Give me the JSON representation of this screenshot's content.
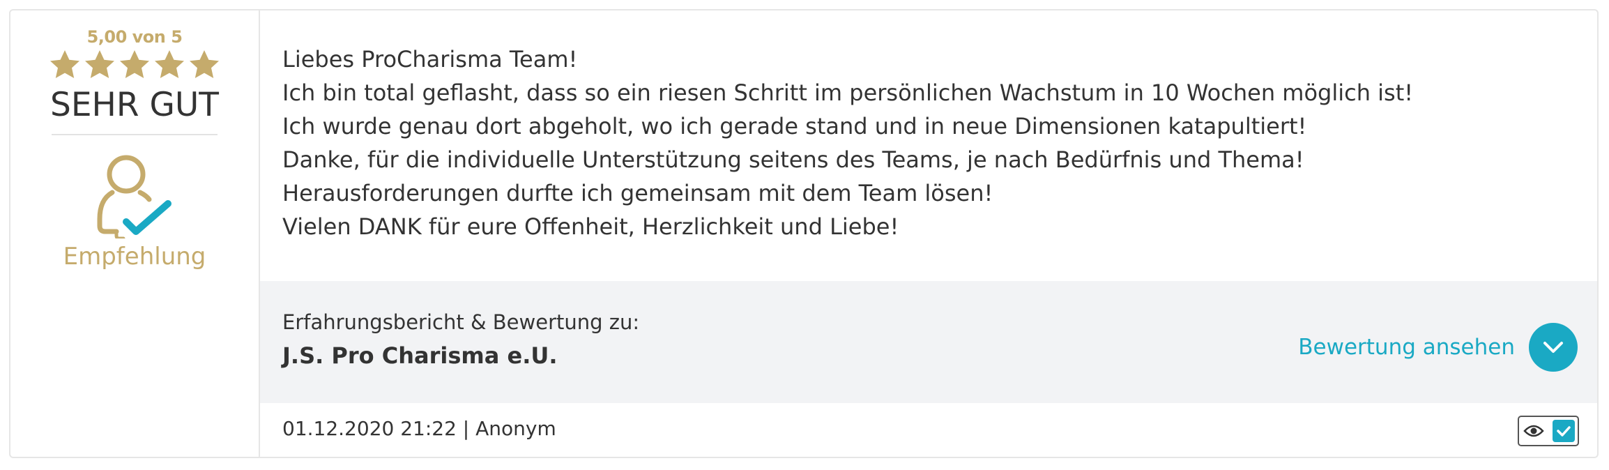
{
  "rating": {
    "score_text": "5,00 von 5",
    "stars": 5,
    "word": "SEHR GUT",
    "recommendation_label": "Empfehlung",
    "star_color": "#c5ab6c"
  },
  "review": {
    "lines": [
      "Liebes ProCharisma Team!",
      "Ich bin total geflasht, dass so ein riesen Schritt im persönlichen Wachstum in 10 Wochen möglich ist!",
      "Ich wurde genau dort abgeholt, wo ich gerade stand und in neue Dimensionen katapultiert!",
      "Danke, für die individuelle Unterstützung seitens des Teams, je nach Bedürfnis und Thema!",
      "Herausforderungen durfte ich gemeinsam mit dem Team lösen!",
      "Vielen DANK für eure Offenheit, Herzlichkeit und Liebe!"
    ]
  },
  "company": {
    "caption": "Erfahrungsbericht & Bewertung zu:",
    "name": "J.S. Pro Charisma e.U.",
    "view_label": "Bewertung ansehen"
  },
  "meta": {
    "date_author": "01.12.2020 21:22 | Anonym"
  },
  "colors": {
    "accent": "#1aa9c4",
    "gold": "#c5ab6c"
  },
  "icons": {
    "star": "star-icon",
    "recommend": "user-check-icon",
    "chevron": "chevron-down-icon",
    "eye": "eye-icon",
    "check": "check-icon"
  }
}
